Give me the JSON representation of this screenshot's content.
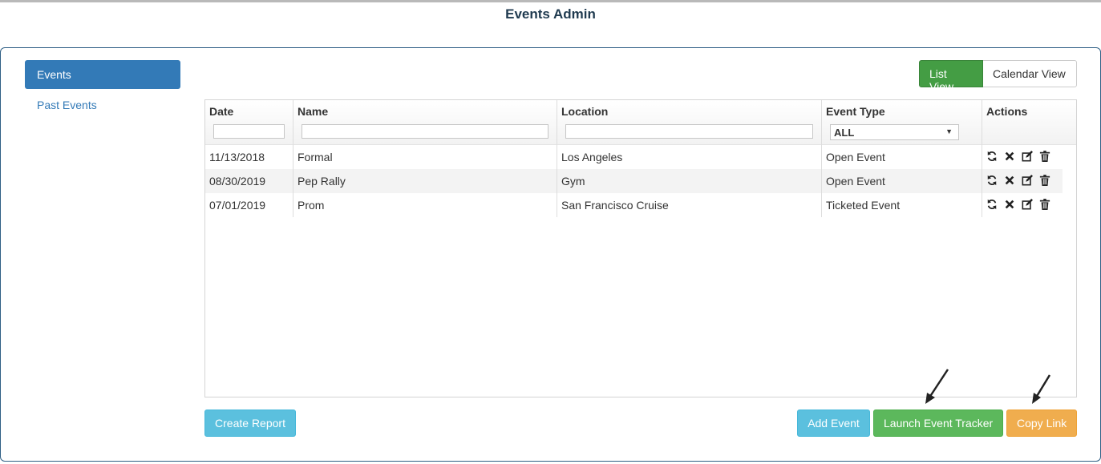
{
  "page": {
    "title": "Events Admin"
  },
  "sidebar": {
    "items": [
      {
        "label": "Events",
        "active": true
      },
      {
        "label": "Past Events",
        "active": false
      }
    ]
  },
  "view_toggle": {
    "list_label": "List View",
    "calendar_label": "Calendar View",
    "selected": "List View"
  },
  "grid": {
    "columns": [
      {
        "label": "Date",
        "filter": ""
      },
      {
        "label": "Name",
        "filter": ""
      },
      {
        "label": "Location",
        "filter": ""
      },
      {
        "label": "Event Type",
        "filter": "ALL"
      },
      {
        "label": "Actions"
      }
    ],
    "rows": [
      {
        "date": "11/13/2018",
        "name": "Formal",
        "location": "Los Angeles",
        "type": "Open Event"
      },
      {
        "date": "08/30/2019",
        "name": "Pep Rally",
        "location": "Gym",
        "type": "Open Event"
      },
      {
        "date": "07/01/2019",
        "name": "Prom",
        "location": "San Francisco Cruise",
        "type": "Ticketed Event"
      }
    ],
    "row_actions": [
      "refresh-icon",
      "close-icon",
      "edit-icon",
      "trash-icon"
    ]
  },
  "buttons": {
    "create_report": "Create Report",
    "add_event": "Add Event",
    "launch_tracker": "Launch Event Tracker",
    "copy_link": "Copy Link"
  },
  "colors": {
    "primary": "#337ab7",
    "success": "#5cb85c",
    "info": "#5bc0de",
    "warning": "#f0ad4e"
  }
}
